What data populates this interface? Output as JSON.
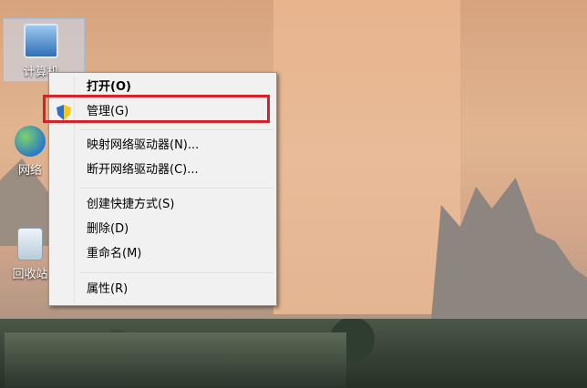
{
  "desktop": {
    "icons": [
      {
        "label": "计算机",
        "icon": "computer-icon"
      },
      {
        "label": "网络",
        "icon": "network-icon"
      },
      {
        "label": "回收站",
        "icon": "recycle-bin-icon"
      }
    ]
  },
  "context_menu": {
    "items": [
      {
        "label": "打开(O)",
        "default": true
      },
      {
        "label": "管理(G)",
        "icon": "uac-shield-icon",
        "highlighted": true
      },
      {
        "label": "映射网络驱动器(N)..."
      },
      {
        "label": "断开网络驱动器(C)..."
      },
      {
        "label": "创建快捷方式(S)"
      },
      {
        "label": "删除(D)"
      },
      {
        "label": "重命名(M)"
      },
      {
        "label": "属性(R)"
      }
    ]
  },
  "annotation": {
    "color": "#d6202a"
  }
}
